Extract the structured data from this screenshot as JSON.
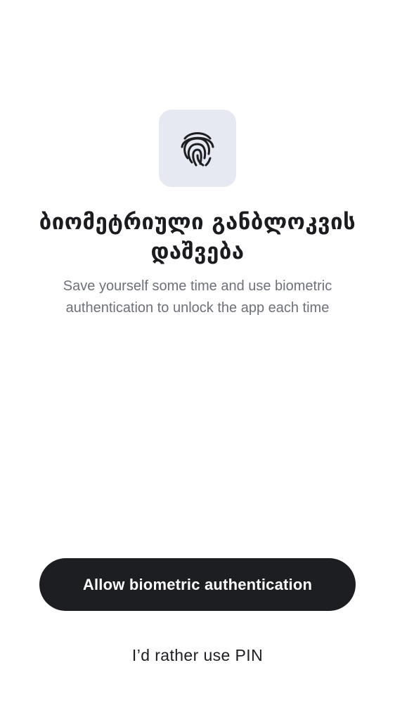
{
  "icon": {
    "name": "fingerprint-icon",
    "tile_color": "#e6e9f2",
    "stroke_color": "#1d1e22"
  },
  "title": "ბიომეტრიული განბლოკვის დაშვება",
  "subtitle": "Save yourself some time and use biometric authentication to unlock the app each time",
  "actions": {
    "primary_label": "Allow biometric authentication",
    "secondary_label": "I’d rather use PIN"
  },
  "colors": {
    "primary_button_bg": "#1d1e22",
    "primary_button_text": "#ffffff",
    "title_text": "#1b1c1f",
    "subtitle_text": "#6e717a"
  }
}
